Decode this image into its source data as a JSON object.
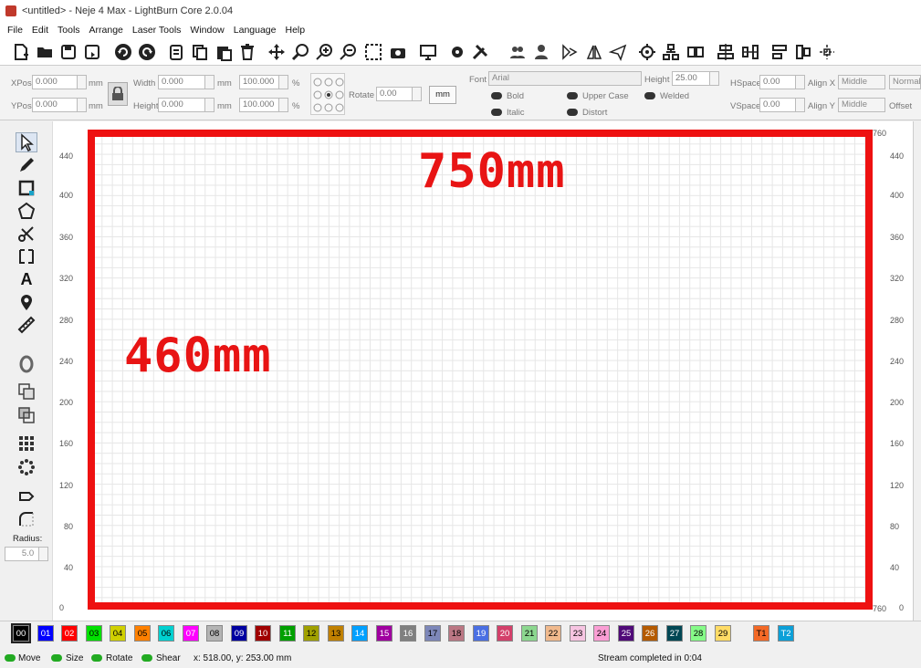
{
  "window": {
    "title": "<untitled> - Neje 4 Max - LightBurn Core 2.0.04"
  },
  "menu": [
    "File",
    "Edit",
    "Tools",
    "Arrange",
    "Laser Tools",
    "Window",
    "Language",
    "Help"
  ],
  "toolbar_icons": [
    "new-file-icon",
    "open-folder-icon",
    "save-icon",
    "save-as-icon",
    "undo-icon",
    "redo-icon",
    "import-icon",
    "copy-icon",
    "paste-icon",
    "delete-icon",
    "move-icon",
    "zoom-fit-icon",
    "zoom-in-icon",
    "zoom-out-icon",
    "frame-icon",
    "camera-icon",
    "monitor-icon",
    "settings-icon",
    "tools-icon",
    "users-icon",
    "user-icon",
    "mirror-h-icon",
    "mirror-v-icon",
    "send-icon",
    "target-icon",
    "align-tree-icon",
    "group-icon",
    "align-center-icon",
    "distribute-icon",
    "align-left-icon",
    "align-right-icon",
    "move-point-icon"
  ],
  "props": {
    "xpos_label": "XPos",
    "xpos_value": "0.000",
    "ypos_label": "YPos",
    "ypos_value": "0.000",
    "unit": "mm",
    "width_label": "Width",
    "width_value": "0.000",
    "height_label": "Height",
    "height_value": "0.000",
    "scale_w": "100.000",
    "scale_h": "100.000",
    "percent": "%",
    "rotate_label": "Rotate",
    "rotate_value": "0.00",
    "mm_button": "mm",
    "font_label": "Font",
    "font_value": "Arial",
    "fheight_label": "Height",
    "fheight_value": "25.00",
    "bold": "Bold",
    "italic": "Italic",
    "upper": "Upper Case",
    "distort": "Distort",
    "welded": "Welded",
    "hspace_label": "HSpace",
    "hspace_value": "0.00",
    "vspace_label": "VSpace",
    "vspace_value": "0.00",
    "alignx_label": "Align X",
    "alignx_value": "Middle",
    "aligny_label": "Align Y",
    "aligny_value": "Middle",
    "normal": "Normal",
    "offset_label": "Offset"
  },
  "left_tools": [
    "select-icon",
    "pencil-icon",
    "rectangle-icon",
    "polygon-icon",
    "cut-icon",
    "frame-tool-icon",
    "text-icon",
    "position-icon",
    "measure-icon",
    "ring-icon",
    "weld-icon",
    "boolean-icon",
    "grid-array-icon",
    "circular-array-icon",
    "rotate-path-icon",
    "corner-icon"
  ],
  "radius": {
    "label": "Radius:",
    "value": "5.0"
  },
  "canvas": {
    "width_note": "750mm",
    "height_note": "460mm",
    "y_ticks": [
      "440",
      "400",
      "360",
      "320",
      "280",
      "240",
      "200",
      "160",
      "120",
      "80",
      "40",
      "0"
    ],
    "corner_label_top": "760",
    "corner_label_bottom": "760"
  },
  "palette": [
    {
      "label": "00",
      "color": "#000000",
      "fg": "#ffffff"
    },
    {
      "label": "01",
      "color": "#0000ff",
      "fg": "#ffffff"
    },
    {
      "label": "02",
      "color": "#ff0000",
      "fg": "#ffffff"
    },
    {
      "label": "03",
      "color": "#00e000",
      "fg": "#000000"
    },
    {
      "label": "04",
      "color": "#d0d000",
      "fg": "#000000"
    },
    {
      "label": "05",
      "color": "#ff8000",
      "fg": "#000000"
    },
    {
      "label": "06",
      "color": "#00d0d0",
      "fg": "#000000"
    },
    {
      "label": "07",
      "color": "#ff00ff",
      "fg": "#ffffff"
    },
    {
      "label": "08",
      "color": "#b4b4b4",
      "fg": "#000000"
    },
    {
      "label": "09",
      "color": "#0000a0",
      "fg": "#ffffff"
    },
    {
      "label": "10",
      "color": "#a00000",
      "fg": "#ffffff"
    },
    {
      "label": "11",
      "color": "#00a000",
      "fg": "#ffffff"
    },
    {
      "label": "12",
      "color": "#a0a000",
      "fg": "#000000"
    },
    {
      "label": "13",
      "color": "#c08000",
      "fg": "#000000"
    },
    {
      "label": "14",
      "color": "#00a0ff",
      "fg": "#ffffff"
    },
    {
      "label": "15",
      "color": "#a000a0",
      "fg": "#ffffff"
    },
    {
      "label": "16",
      "color": "#808080",
      "fg": "#ffffff"
    },
    {
      "label": "17",
      "color": "#7d87b9",
      "fg": "#000000"
    },
    {
      "label": "18",
      "color": "#bb7784",
      "fg": "#000000"
    },
    {
      "label": "19",
      "color": "#4a6fe3",
      "fg": "#ffffff"
    },
    {
      "label": "20",
      "color": "#d33f6a",
      "fg": "#ffffff"
    },
    {
      "label": "21",
      "color": "#8cd78f",
      "fg": "#000000"
    },
    {
      "label": "22",
      "color": "#f0b98d",
      "fg": "#000000"
    },
    {
      "label": "23",
      "color": "#f6c4e1",
      "fg": "#000000"
    },
    {
      "label": "24",
      "color": "#fa9ed4",
      "fg": "#000000"
    },
    {
      "label": "25",
      "color": "#500a78",
      "fg": "#ffffff"
    },
    {
      "label": "26",
      "color": "#b45a00",
      "fg": "#ffffff"
    },
    {
      "label": "27",
      "color": "#004754",
      "fg": "#ffffff"
    },
    {
      "label": "28",
      "color": "#86fa88",
      "fg": "#000000"
    },
    {
      "label": "29",
      "color": "#ffdb66",
      "fg": "#000000"
    },
    {
      "label": "T1",
      "color": "#f36926",
      "fg": "#000000"
    },
    {
      "label": "T2",
      "color": "#0ca0d8",
      "fg": "#ffffff"
    }
  ],
  "status": {
    "move": "Move",
    "size": "Size",
    "rotate": "Rotate",
    "shear": "Shear",
    "coords": "x: 518.00, y: 253.00 mm",
    "message": "Stream completed in 0:04"
  }
}
